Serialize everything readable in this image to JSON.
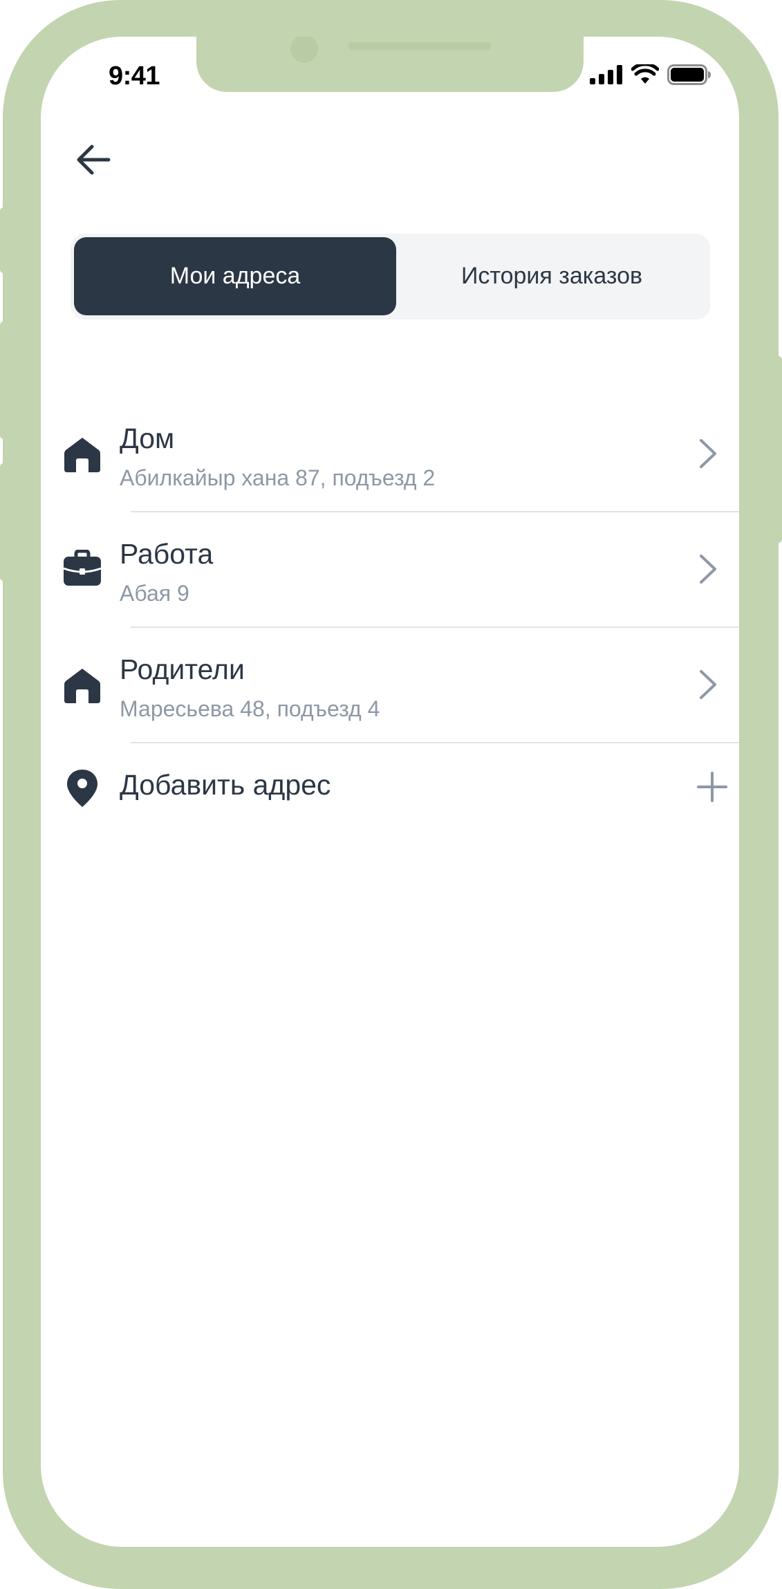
{
  "status_bar": {
    "time": "9:41",
    "icons": [
      "cellular-signal-icon",
      "wifi-icon",
      "battery-icon"
    ]
  },
  "nav": {
    "back_icon": "arrow-left-icon"
  },
  "tabs": [
    {
      "label": "Мои адреса",
      "active": true
    },
    {
      "label": "История заказов",
      "active": false
    }
  ],
  "addresses": [
    {
      "icon": "home-icon",
      "title": "Дом",
      "subtitle": "Абилкайыр хана 87, подъезд 2"
    },
    {
      "icon": "briefcase-icon",
      "title": "Работа",
      "subtitle": "Абая 9"
    },
    {
      "icon": "home-icon",
      "title": "Родители",
      "subtitle": "Маресьева 48, подъезд 4"
    }
  ],
  "add_address": {
    "icon": "location-pin-icon",
    "label": "Добавить адрес",
    "action_icon": "plus-icon"
  },
  "colors": {
    "frame": "#c2d4b0",
    "primary_dark": "#2c3745",
    "secondary_text": "#8d98a5",
    "segment_bg": "#f2f4f5",
    "divider": "#dfe3e6"
  }
}
